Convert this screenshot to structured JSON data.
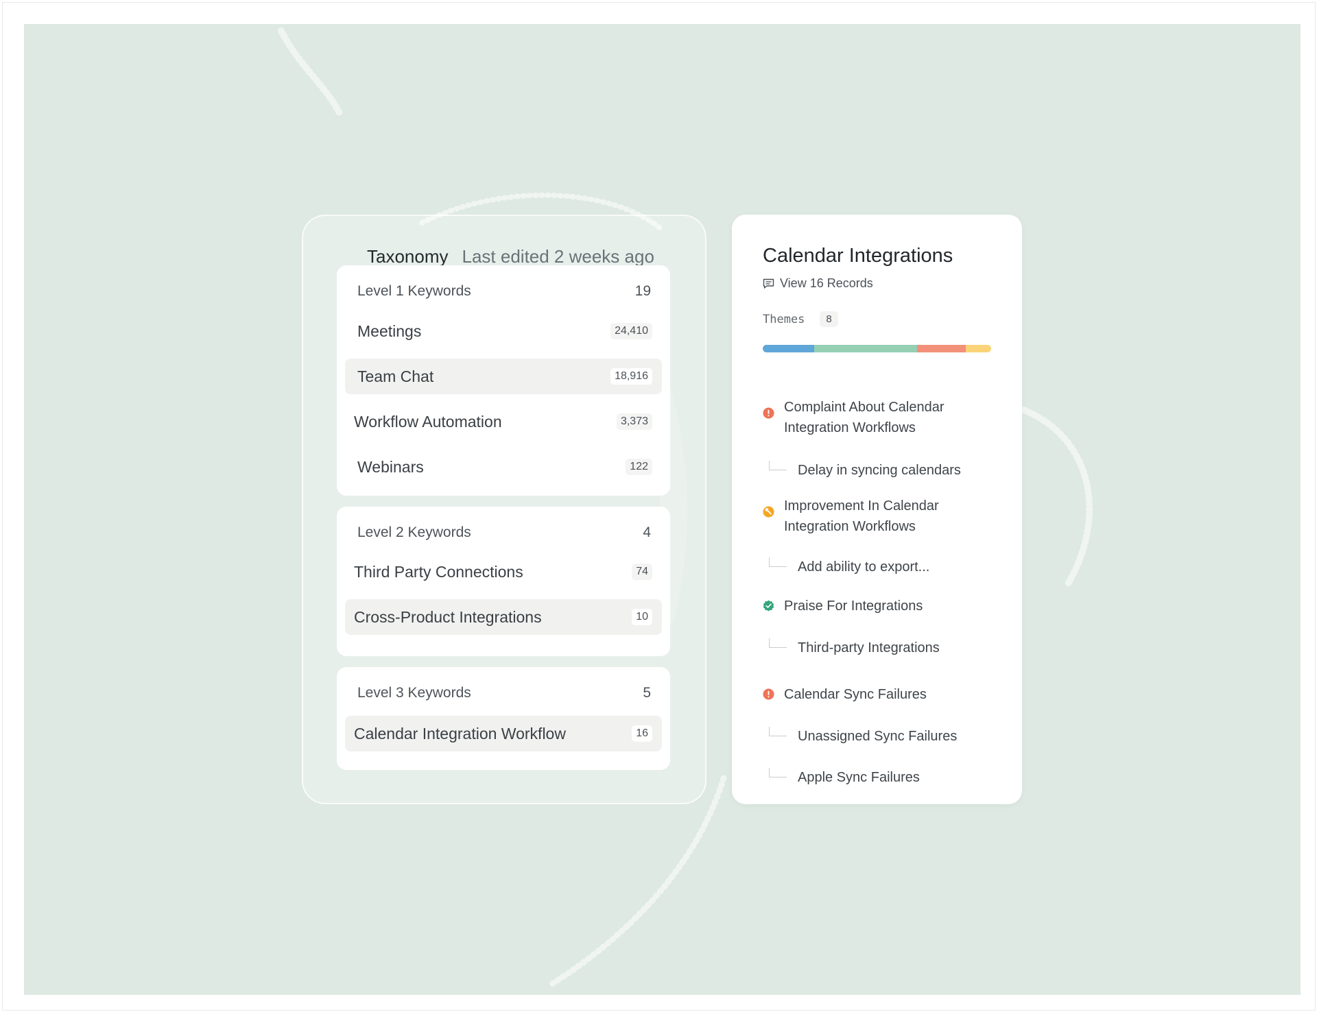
{
  "taxonomy": {
    "title": "Taxonomy",
    "subtitle": "Last edited 2 weeks ago",
    "groups": [
      {
        "label": "Level 1 Keywords",
        "count": "19",
        "items": [
          {
            "label": "Meetings",
            "count": "24,410",
            "selected": false
          },
          {
            "label": "Team Chat",
            "count": "18,916",
            "selected": true
          },
          {
            "label": "Workflow Automation",
            "count": "3,373",
            "selected": false
          },
          {
            "label": "Webinars",
            "count": "122",
            "selected": false
          }
        ]
      },
      {
        "label": "Level 2 Keywords",
        "count": "4",
        "items": [
          {
            "label": "Third Party Connections",
            "count": "74",
            "selected": false
          },
          {
            "label": "Cross-Product Integrations",
            "count": "10",
            "selected": true
          }
        ]
      },
      {
        "label": "Level 3 Keywords",
        "count": "5",
        "items": [
          {
            "label": "Calendar Integration Workflow",
            "count": "16",
            "selected": true
          }
        ]
      }
    ]
  },
  "detail": {
    "title": "Calendar Integrations",
    "records_link": "View 16 Records",
    "themes_label": "Themes",
    "themes_count": "8",
    "theme_distribution": [
      {
        "color": "#5fa6d9",
        "share": 0.225
      },
      {
        "color": "#96cfb4",
        "share": 0.45
      },
      {
        "color": "#f3907a",
        "share": 0.215
      },
      {
        "color": "#fbd47a",
        "share": 0.11
      }
    ],
    "themes": [
      {
        "label": "Complaint About Calendar Integration Workflows",
        "icon": "alert-circle-icon",
        "color": "#ee7358",
        "children": [
          "Delay in syncing calendars"
        ]
      },
      {
        "label": "Improvement In Calendar Integration Workflows",
        "icon": "wrench-circle-icon",
        "color": "#f5a623",
        "children": [
          "Add ability to export..."
        ]
      },
      {
        "label": "Praise For Integrations",
        "icon": "check-badge-icon",
        "color": "#33a67c",
        "children": [
          "Third-party Integrations"
        ]
      },
      {
        "label": "Calendar Sync Failures",
        "icon": "alert-circle-icon",
        "color": "#ee7358",
        "children": [
          "Unassigned Sync Failures",
          "Apple Sync Failures"
        ]
      }
    ]
  }
}
